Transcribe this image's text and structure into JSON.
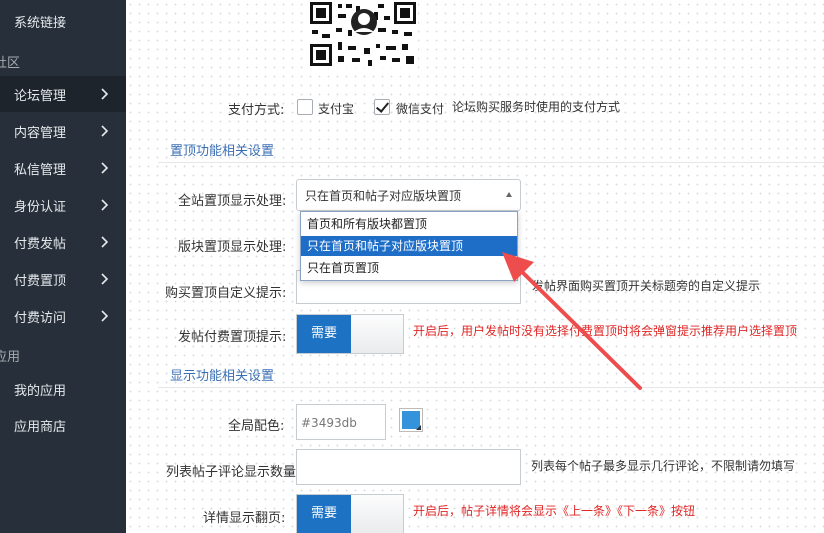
{
  "sidebar": {
    "top_link": "系统链接",
    "section_community": "社区",
    "items": [
      {
        "label": "论坛管理",
        "active": true
      },
      {
        "label": "内容管理"
      },
      {
        "label": "私信管理"
      },
      {
        "label": "身份认证"
      },
      {
        "label": "付费发帖"
      },
      {
        "label": "付费置顶"
      },
      {
        "label": "付费访问"
      }
    ],
    "section_apps": "应用",
    "apps": [
      {
        "label": "我的应用"
      },
      {
        "label": "应用商店"
      }
    ]
  },
  "payment": {
    "label": "支付方式:",
    "option_alipay": "支付宝",
    "option_wechat": "微信支付",
    "alipay_checked": false,
    "wechat_checked": true,
    "hint": "论坛购买服务时使用的支付方式"
  },
  "section_top": "置顶功能相关设置",
  "site_top": {
    "label": "全站置顶显示处理:",
    "value": "只在首页和帖子对应版块置顶",
    "options": [
      "首页和所有版块都置顶",
      "只在首页和帖子对应版块置顶",
      "只在首页置顶"
    ],
    "selected_index": 1
  },
  "board_top": {
    "label": "版块置顶显示处理:"
  },
  "buy_top": {
    "label": "购买置顶自定义提示:",
    "hint": "发帖界面购买置顶开关标题旁的自定义提示"
  },
  "post_top": {
    "label": "发帖付费置顶提示:",
    "toggle_on": "需要",
    "hint": "开启后，用户发帖时没有选择付费置顶时将会弹窗提示推荐用户选择置顶"
  },
  "section_display": "显示功能相关设置",
  "theme_color": {
    "label": "全局配色:",
    "placeholder": "#3493db",
    "color": "#3493db"
  },
  "comment_count": {
    "label": "列表帖子评论显示数量:",
    "hint": "列表每个帖子最多显示几行评论，不限制请勿填写"
  },
  "detail_nav": {
    "label": "详情显示翻页:",
    "toggle_on": "需要",
    "hint": "开启后，帖子详情将会显示《上一条》《下一条》按钮"
  },
  "colors": {
    "sidebar_bg": "#27303a",
    "accent": "#1d72c4",
    "section_title": "#3b6fb5",
    "warn": "#e02626",
    "arrow": "#ee4d4d"
  }
}
